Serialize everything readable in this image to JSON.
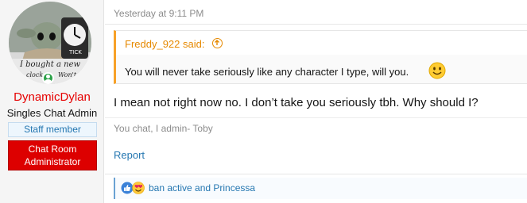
{
  "user": {
    "avatar_caption_line1": "I bought a new",
    "avatar_caption_line2_left": "clock",
    "avatar_caption_line2_right": "Won't",
    "name": "DynamicDylan",
    "title": "Singles Chat Admin",
    "banner_staff": "Staff member",
    "banner_admin_line1": "Chat Room",
    "banner_admin_line2": "Administrator",
    "online_icon": "online-user-icon"
  },
  "message": {
    "date": "Yesterday at 9:11 PM",
    "quote": {
      "author": "Freddy_922 said:",
      "expand_icon": "arrow-up-circle-icon",
      "text": "You will never take seriously like any character I type, will you.",
      "emoji": "smiley-icon"
    },
    "body": "I mean not right now no. I don’t take you seriously tbh. Why should I?",
    "signature": "You chat, I admin- Toby",
    "report_label": "Report",
    "reactions": {
      "icons": [
        "like-icon",
        "love-icon"
      ],
      "text": "ban active and Princessa"
    }
  },
  "colors": {
    "username": "#e60000",
    "link": "#2577b1",
    "quote_accent": "#f7a128",
    "admin_banner": "#dd0000",
    "staff_banner": "#edf6fd"
  }
}
